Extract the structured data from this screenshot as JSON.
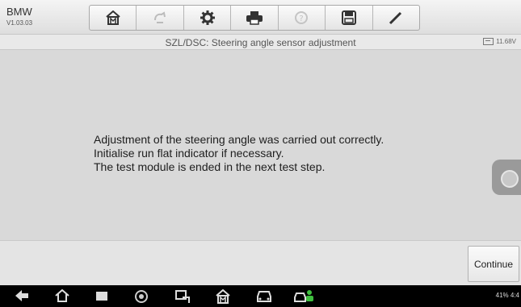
{
  "header": {
    "app_name": "BMW",
    "version": "V1.03.03",
    "toolbar": [
      {
        "icon": "home-icon"
      },
      {
        "icon": "vehicle-swap-icon"
      },
      {
        "icon": "settings-gear-icon"
      },
      {
        "icon": "print-icon"
      },
      {
        "icon": "help-icon"
      },
      {
        "icon": "save-icon"
      },
      {
        "icon": "pen-icon"
      }
    ]
  },
  "titlebar": {
    "title": "SZL/DSC: Steering angle sensor adjustment",
    "voltage": "11.68V"
  },
  "message": {
    "lines": [
      "Adjustment of the steering angle was carried out correctly.",
      "Initialise run flat indicator if necessary.",
      "The test module is ended in the next test step."
    ]
  },
  "actions": {
    "continue_label": "Continue"
  },
  "navbar": {
    "icons": [
      "back-icon",
      "home-icon",
      "recent-apps-icon",
      "browser-icon",
      "screenshot-icon",
      "maxisys-home-icon",
      "vehicle-icon",
      "remote-desk-icon"
    ],
    "status_text": "41% 4:4"
  },
  "colors": {
    "background": "#d9d9d9",
    "navbar": "#000000"
  }
}
